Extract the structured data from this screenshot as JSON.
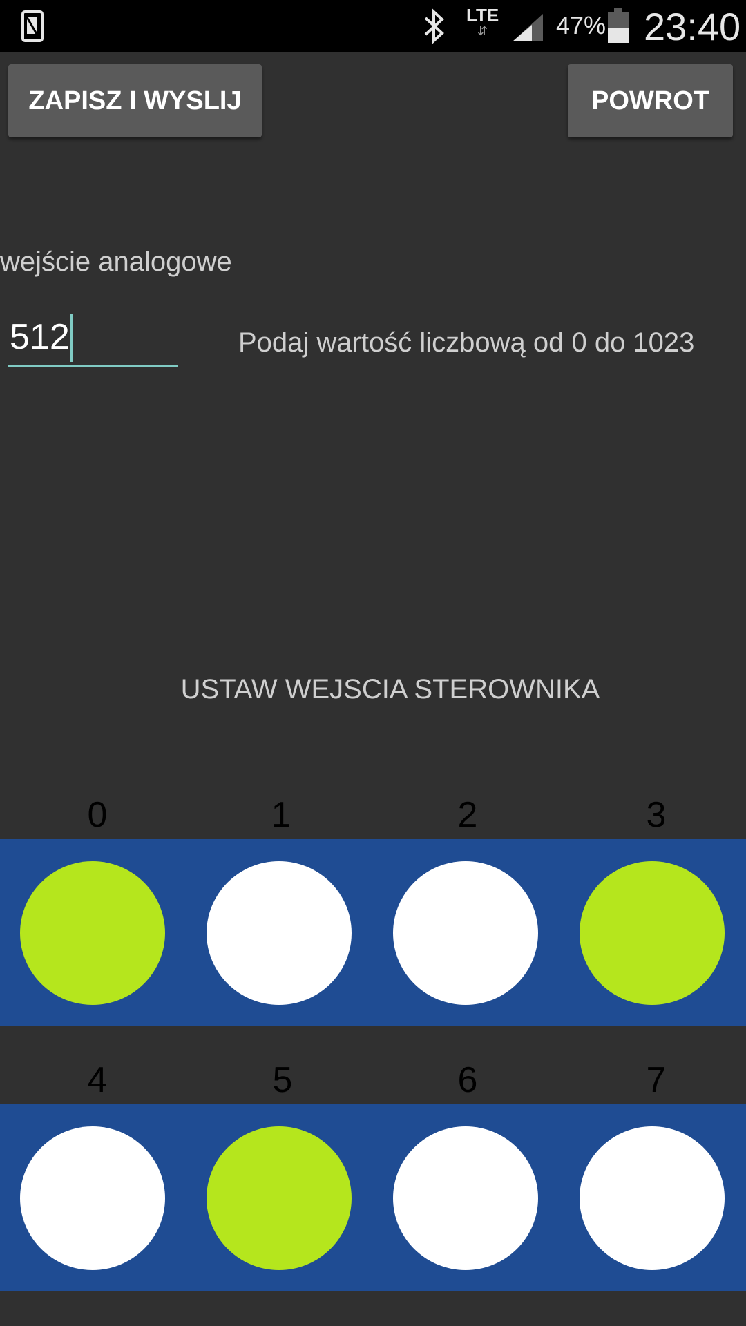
{
  "status_bar": {
    "icons": [
      "sim-card-icon",
      "bluetooth-icon",
      "lte-icon",
      "signal-icon",
      "battery-icon"
    ],
    "network": "LTE",
    "battery_percent": "47%",
    "time": "23:40"
  },
  "toolbar": {
    "save_label": "ZAPISZ I WYSLIJ",
    "back_label": "POWROT"
  },
  "analog": {
    "label": "wejście analogowe",
    "value": "512",
    "hint": "Podaj wartość liczbową od 0 do 1023"
  },
  "section": {
    "title": "USTAW WEJSCIA STEROWNIKA"
  },
  "inputs": [
    {
      "label": "0",
      "state": "on"
    },
    {
      "label": "1",
      "state": "off"
    },
    {
      "label": "2",
      "state": "off"
    },
    {
      "label": "3",
      "state": "on"
    },
    {
      "label": "4",
      "state": "off"
    },
    {
      "label": "5",
      "state": "on"
    },
    {
      "label": "6",
      "state": "off"
    },
    {
      "label": "7",
      "state": "off"
    }
  ],
  "colors": {
    "background": "#303030",
    "band": "#1f4c93",
    "led_on": "#b5e61d",
    "led_off": "#ffffff",
    "accent": "#80cbc4"
  }
}
